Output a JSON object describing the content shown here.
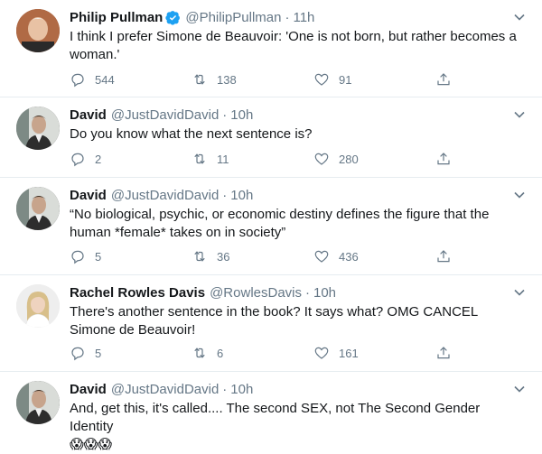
{
  "tweets": [
    {
      "name": "Philip Pullman",
      "verified": true,
      "handle": "@PhilipPullman",
      "separator": "·",
      "time": "11h",
      "text": "I think I prefer Simone de Beauvoir: 'One is not born, but rather becomes a woman.'",
      "replies": "544",
      "retweets": "138",
      "likes": "91"
    },
    {
      "name": "David",
      "handle": "@JustDavidDavid",
      "separator": "·",
      "time": "10h",
      "text": "Do you know what the next sentence is?",
      "replies": "2",
      "retweets": "11",
      "likes": "280"
    },
    {
      "name": "David",
      "handle": "@JustDavidDavid",
      "separator": "·",
      "time": "10h",
      "text": "“No biological, psychic, or economic destiny defines the figure that the human *female* takes on in society”",
      "replies": "5",
      "retweets": "36",
      "likes": "436"
    },
    {
      "name": "Rachel Rowles Davis",
      "handle": "@RowlesDavis",
      "separator": "·",
      "time": "10h",
      "text": "There's another sentence in the book?  It says what?  OMG CANCEL Simone de Beauvoir!",
      "replies": "5",
      "retweets": "6",
      "likes": "161"
    },
    {
      "name": "David",
      "handle": "@JustDavidDavid",
      "separator": "·",
      "time": "10h",
      "text": "And, get this, it's called.... The second SEX, not The Second Gender Identity",
      "emoji": "😱😱😱"
    }
  ],
  "icons": {
    "reply": "reply-icon",
    "retweet": "retweet-icon",
    "like": "heart-icon",
    "share": "share-icon",
    "more": "chevron-down-icon",
    "verified": "verified-badge-icon"
  },
  "colors": {
    "name": "#14171a",
    "secondary": "#657786",
    "verified": "#1da1f2",
    "divider": "#e6ecf0"
  }
}
